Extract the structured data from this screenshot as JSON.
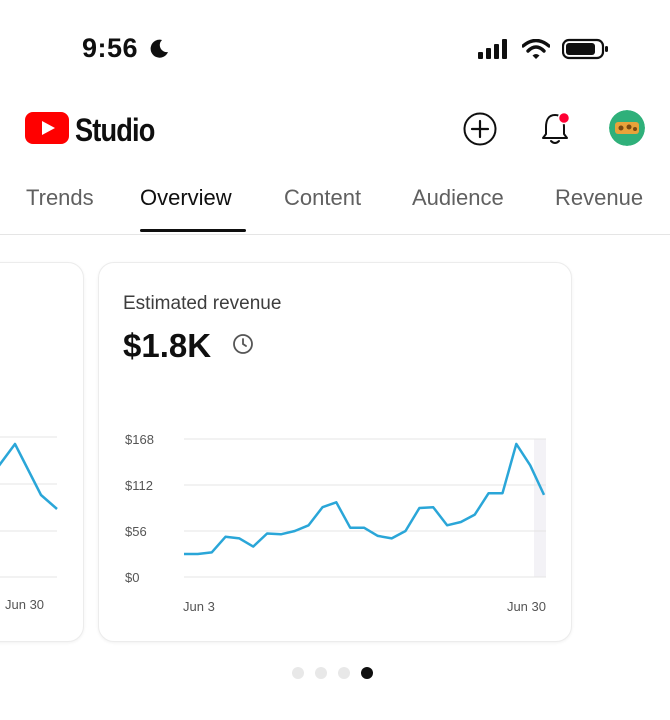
{
  "status_bar": {
    "time": "9:56"
  },
  "header": {
    "app_name": "Studio"
  },
  "tabs": [
    {
      "label": "Trends",
      "active": false
    },
    {
      "label": "Overview",
      "active": true
    },
    {
      "label": "Content",
      "active": false
    },
    {
      "label": "Audience",
      "active": false
    },
    {
      "label": "Revenue",
      "active": false
    }
  ],
  "left_card": {
    "x_label": "Jun 30"
  },
  "revenue_card": {
    "title": "Estimated revenue",
    "value": "$1.8K"
  },
  "chart_data": {
    "type": "line",
    "title": "",
    "xlabel": "",
    "ylabel": "",
    "x_tick_labels": [
      "Jun 3",
      "Jun 30"
    ],
    "y_tick_labels": [
      "$0",
      "$56",
      "$112",
      "$168"
    ],
    "ylim": [
      0,
      168
    ],
    "grid": true,
    "color": "#2aa6d8",
    "x": [
      "Jun 3",
      "Jun 4",
      "Jun 5",
      "Jun 6",
      "Jun 7",
      "Jun 8",
      "Jun 9",
      "Jun 10",
      "Jun 11",
      "Jun 12",
      "Jun 13",
      "Jun 14",
      "Jun 15",
      "Jun 16",
      "Jun 17",
      "Jun 18",
      "Jun 19",
      "Jun 20",
      "Jun 21",
      "Jun 22",
      "Jun 23",
      "Jun 24",
      "Jun 25",
      "Jun 26",
      "Jun 27",
      "Jun 28",
      "Jun 29",
      "Jun 30"
    ],
    "values": [
      28,
      28,
      30,
      49,
      47,
      37,
      53,
      52,
      56,
      63,
      85,
      91,
      60,
      60,
      50,
      47,
      56,
      84,
      85,
      63,
      67,
      76,
      102,
      102,
      162,
      136,
      100
    ]
  },
  "pagination": {
    "count": 4,
    "active": 3
  },
  "colors": {
    "youtube_red": "#ff0000",
    "notification_dot": "#ff0033",
    "chart_line": "#2aa6d8"
  }
}
